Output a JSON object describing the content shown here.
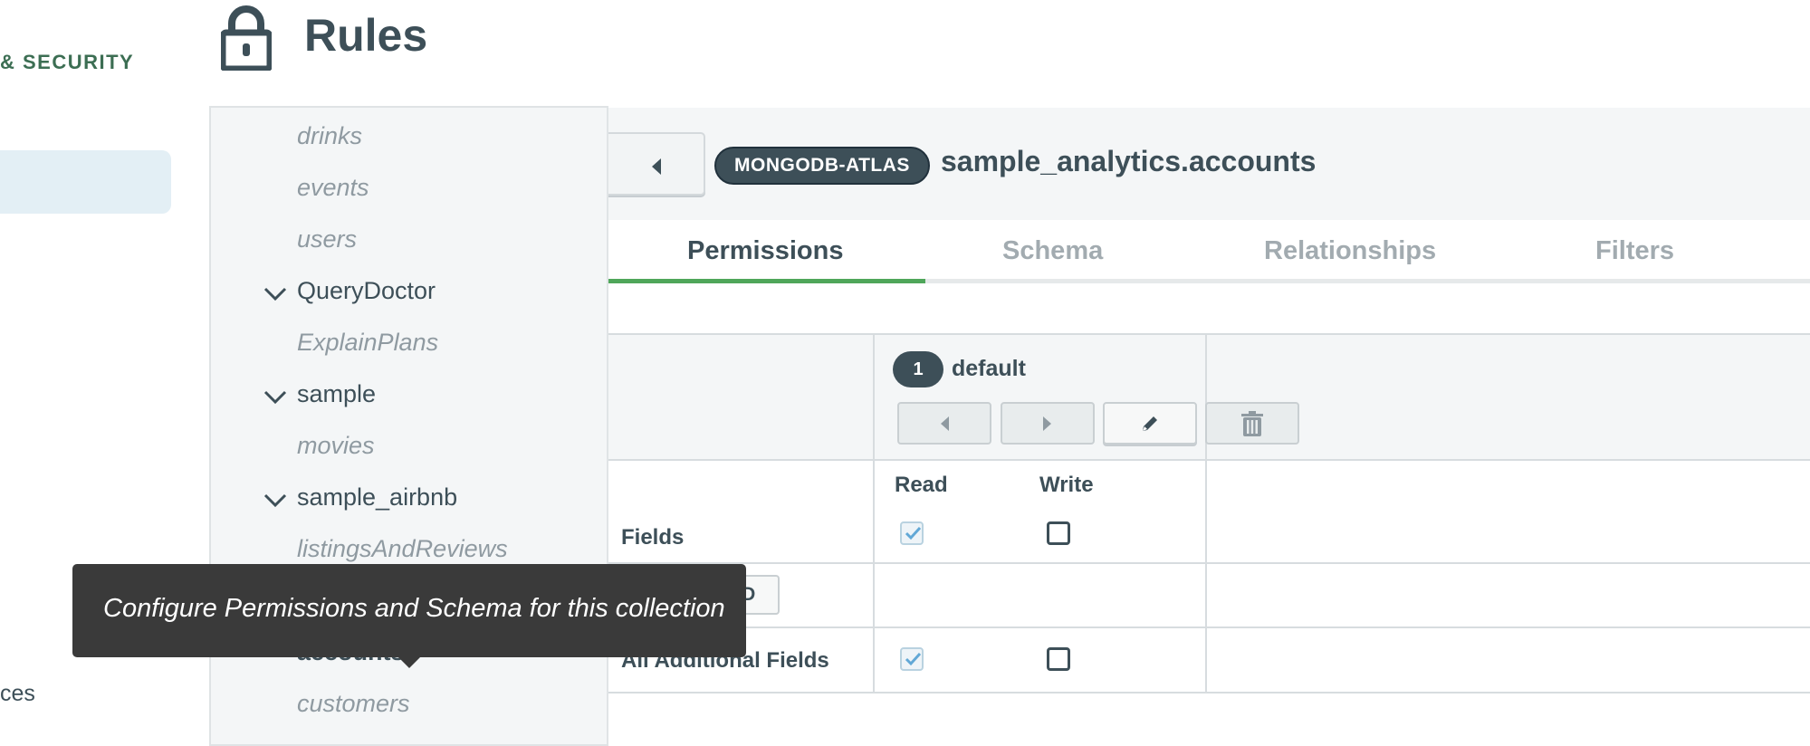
{
  "nav": {
    "section_label": "& SECURITY",
    "partial_item": "ces"
  },
  "header": {
    "title": "Rules",
    "icon": "lock-icon"
  },
  "tree": {
    "items": [
      {
        "label": "drinks",
        "kind": "collection"
      },
      {
        "label": "events",
        "kind": "collection"
      },
      {
        "label": "users",
        "kind": "collection"
      },
      {
        "label": "QueryDoctor",
        "kind": "database"
      },
      {
        "label": "ExplainPlans",
        "kind": "collection"
      },
      {
        "label": "sample",
        "kind": "database"
      },
      {
        "label": "movies",
        "kind": "collection"
      },
      {
        "label": "sample_airbnb",
        "kind": "database"
      },
      {
        "label": "listingsAndReviews",
        "kind": "collection"
      },
      {
        "label": "sample_analytics",
        "kind": "database"
      },
      {
        "label": "accounts",
        "kind": "collection-selected"
      },
      {
        "label": "customers",
        "kind": "collection"
      }
    ]
  },
  "collection": {
    "source": "MONGODB-ATLAS",
    "namespace": "sample_analytics.accounts"
  },
  "tabs": [
    {
      "label": "Permissions",
      "active": true
    },
    {
      "label": "Schema",
      "active": false
    },
    {
      "label": "Relationships",
      "active": false
    },
    {
      "label": "Filters",
      "active": false
    }
  ],
  "permissions": {
    "role": {
      "order": "1",
      "name": "default"
    },
    "columns": {
      "read": "Read",
      "write": "Write"
    },
    "fields_label": "Fields",
    "add_field_label": "+ ADD FIELD",
    "rows": [
      {
        "label": "Fields",
        "read": true,
        "write": false
      },
      {
        "label": "All Additional Fields",
        "read": true,
        "write": false
      }
    ]
  },
  "tooltip": {
    "text": "Configure Permissions and Schema for this collection"
  },
  "colors": {
    "accent_green": "#4fa65a",
    "text_dark": "#3d4f58",
    "nav_green": "#3c6e53",
    "tooltip_bg": "#3a3a3a"
  }
}
